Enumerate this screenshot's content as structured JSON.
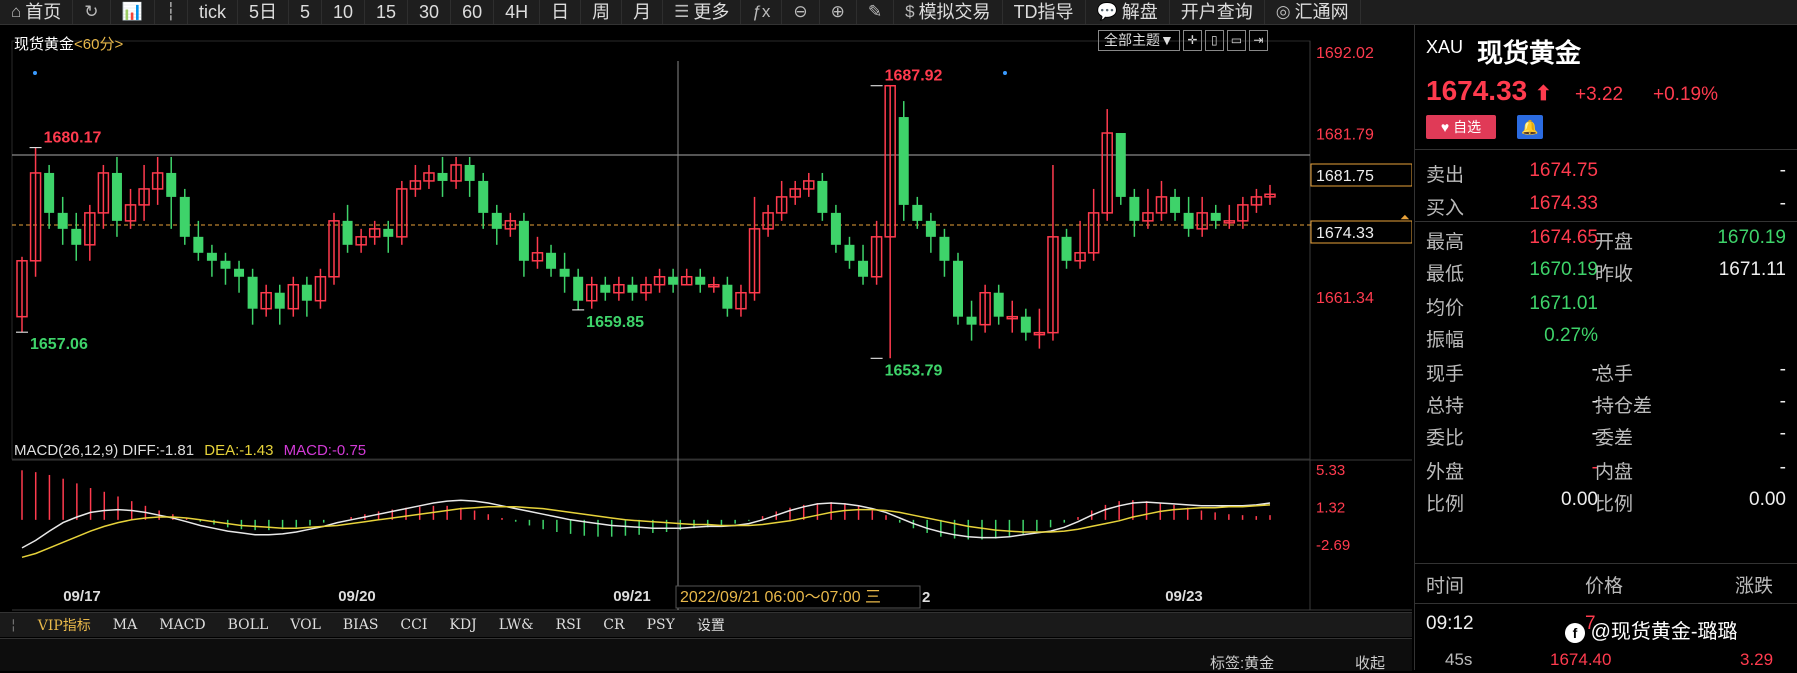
{
  "toolbar": [
    {
      "icon": "⌂",
      "label": "首页"
    },
    {
      "icon": "↻",
      "label": ""
    },
    {
      "icon": "📊",
      "label": ""
    },
    {
      "icon": "┆",
      "label": ""
    },
    {
      "icon": "",
      "label": "tick"
    },
    {
      "icon": "",
      "label": "5日"
    },
    {
      "icon": "",
      "label": "5"
    },
    {
      "icon": "",
      "label": "10"
    },
    {
      "icon": "",
      "label": "15"
    },
    {
      "icon": "",
      "label": "30"
    },
    {
      "icon": "",
      "label": "60"
    },
    {
      "icon": "",
      "label": "4H"
    },
    {
      "icon": "",
      "label": "日"
    },
    {
      "icon": "",
      "label": "周"
    },
    {
      "icon": "",
      "label": "月"
    },
    {
      "icon": "☰",
      "label": "更多"
    },
    {
      "icon": "ƒx",
      "label": ""
    },
    {
      "icon": "⊖",
      "label": ""
    },
    {
      "icon": "⊕",
      "label": ""
    },
    {
      "icon": "✎",
      "label": ""
    },
    {
      "icon": "$",
      "label": "模拟交易"
    },
    {
      "icon": "",
      "label": "TD指导"
    },
    {
      "icon": "💬",
      "label": "解盘"
    },
    {
      "icon": "",
      "label": "开户查询"
    },
    {
      "icon": "◎",
      "label": "汇通网"
    }
  ],
  "chart": {
    "title_name": "现货黄金",
    "title_period": "<60分>",
    "theme_select": "全部主题▼",
    "tool_buttons": [
      "✛",
      "▯",
      "▭",
      "⇥"
    ],
    "y_labels": [
      {
        "v": "1692.02",
        "price": 1692.02,
        "color": "#ff3b4e"
      },
      {
        "v": "1681.79",
        "price": 1681.79,
        "color": "#ff3b4e"
      },
      {
        "v": "1661.34",
        "price": 1661.34,
        "color": "#ff3b4e"
      }
    ],
    "crosshair_price": "1681.75",
    "last_price": "1674.33",
    "marks": [
      {
        "text": "1680.17",
        "color": "#ff3b4e"
      },
      {
        "text": "1657.06",
        "color": "#3ed36a"
      },
      {
        "text": "1659.85",
        "color": "#3ed36a"
      },
      {
        "text": "1687.92",
        "color": "#ff3b4e"
      },
      {
        "text": "1653.79",
        "color": "#3ed36a"
      }
    ],
    "x_labels": [
      "09/17",
      "09/20",
      "09/21",
      "09/23"
    ],
    "x_tooltip": "2022/09/21 06:00～07:00 三",
    "x_after_tip": "2"
  },
  "macd": {
    "name": "MACD(26,12,9)",
    "diff": "DIFF:-1.81",
    "dea": "DEA:-1.43",
    "macd": "MACD:-0.75",
    "y_labels": [
      "5.33",
      "1.32",
      "-2.69"
    ]
  },
  "indicator_tabs": [
    "VIP指标",
    "MA",
    "MACD",
    "BOLL",
    "VOL",
    "BIAS",
    "CCI",
    "KDJ",
    "LW&",
    "RSI",
    "CR",
    "PSY",
    "设置"
  ],
  "footbar": {
    "tag": "标签:黄金",
    "collapse": "收起"
  },
  "quote": {
    "code": "XAU",
    "name": "现货黄金",
    "price": "1674.33",
    "arrow": "⬆",
    "change": "+3.22",
    "pct": "+0.19%",
    "fav": "♥ 自选",
    "bell": "🔔",
    "rows": [
      {
        "a": "卖出",
        "b": "1674.75",
        "bc": "red",
        "c": "",
        "d": "-",
        "dc": "wht"
      },
      {
        "a": "买入",
        "b": "1674.33",
        "bc": "red",
        "c": "",
        "d": "-",
        "dc": "wht"
      },
      {
        "a": "最高",
        "b": "1674.65",
        "bc": "red",
        "c": "开盘",
        "d": "1670.19",
        "dc": "grn"
      },
      {
        "a": "最低",
        "b": "1670.19",
        "bc": "grn",
        "c": "昨收",
        "d": "1671.11",
        "dc": "wht"
      },
      {
        "a": "均价",
        "b": "1671.01",
        "bc": "grn",
        "c": "",
        "d": "",
        "dc": "wht"
      },
      {
        "a": "振幅",
        "b": "0.27%",
        "bc": "grn",
        "c": "",
        "d": "",
        "dc": "wht"
      },
      {
        "a": "现手",
        "b": "-",
        "bc": "wht",
        "c": "总手",
        "d": "-",
        "dc": "wht"
      },
      {
        "a": "总持",
        "b": "-",
        "bc": "wht",
        "c": "持仓差",
        "d": "-",
        "dc": "wht"
      },
      {
        "a": "委比",
        "b": "-",
        "bc": "wht",
        "c": "委差",
        "d": "-",
        "dc": "wht"
      },
      {
        "a": "外盘",
        "b": "-",
        "bc": "red",
        "c": "内盘",
        "d": "-",
        "dc": "wht"
      },
      {
        "a": "比例",
        "b": "0.00",
        "bc": "wht",
        "c": "比例",
        "d": "0.00",
        "dc": "wht"
      }
    ],
    "trade_header": [
      "时间",
      "价格",
      "涨跌"
    ],
    "trades": [
      {
        "t": "09:12",
        "p": "7",
        "c": ""
      },
      {
        "t": "45s",
        "p": "1674.40",
        "c": "3.29"
      }
    ],
    "watermark": "@现货黄金-璐璐"
  },
  "chart_data": {
    "type": "candlestick",
    "y_range": [
      1650,
      1694
    ],
    "candles": [
      [
        1659,
        1666,
        1657.06,
        1666.5
      ],
      [
        1666,
        1677,
        1664,
        1680.17
      ],
      [
        1677,
        1672,
        1670,
        1678
      ],
      [
        1672,
        1670,
        1668,
        1674
      ],
      [
        1670,
        1668,
        1666,
        1672
      ],
      [
        1668,
        1672,
        1666,
        1673
      ],
      [
        1672,
        1677,
        1670,
        1678
      ],
      [
        1677,
        1671,
        1669,
        1679
      ],
      [
        1671,
        1673,
        1670,
        1675
      ],
      [
        1673,
        1675,
        1671,
        1678
      ],
      [
        1675,
        1677,
        1673,
        1679
      ],
      [
        1677,
        1674,
        1670,
        1679
      ],
      [
        1674,
        1669,
        1668,
        1675
      ],
      [
        1669,
        1667,
        1666,
        1671
      ],
      [
        1667,
        1666,
        1664,
        1668
      ],
      [
        1666,
        1665,
        1663,
        1667
      ],
      [
        1665,
        1664,
        1662,
        1666
      ],
      [
        1664,
        1660,
        1658,
        1665
      ],
      [
        1660,
        1662,
        1659,
        1663
      ],
      [
        1662,
        1660,
        1658,
        1663
      ],
      [
        1660,
        1663,
        1659,
        1664
      ],
      [
        1663,
        1661,
        1659,
        1664
      ],
      [
        1661,
        1664,
        1660,
        1665
      ],
      [
        1664,
        1671,
        1663,
        1672
      ],
      [
        1671,
        1668,
        1667,
        1673
      ],
      [
        1668,
        1669,
        1667,
        1670
      ],
      [
        1669,
        1670,
        1668,
        1671
      ],
      [
        1670,
        1669,
        1667,
        1671
      ],
      [
        1669,
        1675,
        1668,
        1676
      ],
      [
        1675,
        1676,
        1674,
        1678
      ],
      [
        1676,
        1677,
        1675,
        1678
      ],
      [
        1677,
        1676,
        1674,
        1679
      ],
      [
        1676,
        1678,
        1675,
        1679
      ],
      [
        1678,
        1676,
        1674,
        1679
      ],
      [
        1676,
        1672,
        1670,
        1677
      ],
      [
        1672,
        1670,
        1668,
        1673
      ],
      [
        1670,
        1671,
        1669,
        1672
      ],
      [
        1671,
        1666,
        1664,
        1672
      ],
      [
        1666,
        1667,
        1665,
        1669
      ],
      [
        1667,
        1665,
        1664,
        1668
      ],
      [
        1665,
        1664,
        1662,
        1667
      ],
      [
        1664,
        1661,
        1659.85,
        1665
      ],
      [
        1661,
        1663,
        1660,
        1664
      ],
      [
        1663,
        1662,
        1661,
        1664
      ],
      [
        1662,
        1663,
        1661,
        1664
      ],
      [
        1663,
        1662,
        1661,
        1664
      ],
      [
        1662,
        1663,
        1661,
        1664
      ],
      [
        1663,
        1664,
        1662,
        1665
      ],
      [
        1664,
        1663,
        1662,
        1665
      ],
      [
        1663,
        1664,
        1663,
        1665
      ],
      [
        1664,
        1663,
        1662,
        1665
      ],
      [
        1663,
        1663,
        1662,
        1664
      ],
      [
        1663,
        1660,
        1659,
        1664
      ],
      [
        1660,
        1662,
        1659,
        1663
      ],
      [
        1662,
        1670,
        1661,
        1674
      ],
      [
        1670,
        1672,
        1669,
        1673
      ],
      [
        1672,
        1674,
        1671,
        1676
      ],
      [
        1674,
        1675,
        1673,
        1676
      ],
      [
        1675,
        1676,
        1674,
        1677
      ],
      [
        1676,
        1672,
        1671,
        1677
      ],
      [
        1672,
        1668,
        1667,
        1673
      ],
      [
        1668,
        1666,
        1665,
        1669
      ],
      [
        1666,
        1664,
        1663,
        1668
      ],
      [
        1664,
        1669,
        1663,
        1671
      ],
      [
        1669,
        1687.92,
        1653.79,
        1687.92
      ],
      [
        1684,
        1673,
        1671,
        1686
      ],
      [
        1673,
        1671,
        1670,
        1674
      ],
      [
        1671,
        1669,
        1667,
        1672
      ],
      [
        1669,
        1666,
        1664,
        1670
      ],
      [
        1666,
        1659,
        1658,
        1667
      ],
      [
        1659,
        1658,
        1656,
        1661
      ],
      [
        1658,
        1662,
        1657,
        1663
      ],
      [
        1662,
        1659,
        1658,
        1663
      ],
      [
        1659,
        1659,
        1657,
        1661
      ],
      [
        1659,
        1657,
        1656,
        1660
      ],
      [
        1657,
        1657,
        1655,
        1660
      ],
      [
        1657,
        1669,
        1656,
        1678
      ],
      [
        1669,
        1666,
        1665,
        1670
      ],
      [
        1666,
        1667,
        1665,
        1671
      ],
      [
        1667,
        1672,
        1666,
        1675
      ],
      [
        1672,
        1682,
        1671,
        1685
      ],
      [
        1682,
        1674,
        1673,
        1682
      ],
      [
        1674,
        1671,
        1669,
        1675
      ],
      [
        1671,
        1672,
        1670,
        1675
      ],
      [
        1672,
        1674,
        1671,
        1676
      ],
      [
        1674,
        1672,
        1671,
        1675
      ],
      [
        1672,
        1670,
        1669,
        1674
      ],
      [
        1670,
        1672,
        1669,
        1674
      ],
      [
        1672,
        1671,
        1670,
        1673
      ],
      [
        1671,
        1671,
        1670,
        1673
      ],
      [
        1671,
        1673,
        1670,
        1674
      ],
      [
        1673,
        1674,
        1672,
        1675
      ],
      [
        1674,
        1674.33,
        1673,
        1675.5
      ]
    ],
    "macd_hist": [
      5.3,
      5.1,
      4.8,
      4.4,
      3.9,
      3.4,
      3.0,
      2.5,
      2.0,
      1.5,
      1.0,
      0.6,
      0.2,
      -0.2,
      -0.5,
      -0.8,
      -1.0,
      -1.1,
      -1.1,
      -1.0,
      -0.8,
      -0.6,
      -0.3,
      0,
      0.3,
      0.6,
      0.9,
      1.1,
      1.3,
      1.4,
      1.5,
      1.5,
      1.3,
      1.0,
      0.6,
      0.2,
      -0.2,
      -0.6,
      -1.0,
      -1.3,
      -1.5,
      -1.7,
      -1.8,
      -1.8,
      -1.7,
      -1.6,
      -1.4,
      -1.3,
      -1.1,
      -0.9,
      -0.8,
      -0.6,
      -0.4,
      -0.1,
      0.4,
      0.9,
      1.3,
      1.6,
      1.8,
      1.9,
      1.8,
      1.5,
      1.0,
      0.5,
      -0.3,
      -0.9,
      -1.4,
      -1.8,
      -2.0,
      -2.1,
      -2.1,
      -2.0,
      -1.8,
      -1.5,
      -1.2,
      -0.8,
      -0.3,
      0.3,
      1.0,
      1.6,
      2.0,
      2.1,
      2.0,
      1.8,
      1.6,
      1.3,
      1.0,
      0.8,
      0.6,
      0.5,
      0.4,
      0.5
    ],
    "diff": [
      -3.0,
      -2.2,
      -1.2,
      -0.3,
      0.3,
      0.8,
      1.0,
      1.1,
      1.0,
      0.8,
      0.5,
      0.2,
      -0.2,
      -0.6,
      -0.9,
      -1.2,
      -1.4,
      -1.6,
      -1.6,
      -1.5,
      -1.3,
      -1.0,
      -0.7,
      -0.3,
      0.0,
      0.3,
      0.6,
      0.9,
      1.2,
      1.5,
      1.8,
      2.0,
      2.1,
      2.0,
      1.8,
      1.5,
      1.2,
      0.9,
      0.6,
      0.3,
      0.0,
      -0.2,
      -0.4,
      -0.6,
      -0.7,
      -0.8,
      -0.9,
      -0.9,
      -0.9,
      -0.8,
      -0.7,
      -0.7,
      -0.6,
      -0.4,
      0.0,
      0.5,
      1.0,
      1.4,
      1.7,
      1.8,
      1.7,
      1.5,
      1.2,
      0.8,
      0.2,
      -0.4,
      -0.9,
      -1.3,
      -1.6,
      -1.8,
      -1.9,
      -1.9,
      -1.8,
      -1.6,
      -1.4,
      -1.2,
      -0.8,
      -0.2,
      0.5,
      1.1,
      1.5,
      1.8,
      1.9,
      1.8,
      1.7,
      1.6,
      1.5,
      1.5,
      1.5,
      1.5,
      1.6,
      1.8
    ],
    "dea": [
      -4.0,
      -3.6,
      -3.0,
      -2.4,
      -1.8,
      -1.2,
      -0.7,
      -0.3,
      0.0,
      0.2,
      0.3,
      0.3,
      0.2,
      0.0,
      -0.2,
      -0.4,
      -0.6,
      -0.7,
      -0.8,
      -0.9,
      -0.9,
      -0.8,
      -0.7,
      -0.6,
      -0.4,
      -0.2,
      0.0,
      0.2,
      0.4,
      0.6,
      0.8,
      1.0,
      1.2,
      1.3,
      1.4,
      1.4,
      1.4,
      1.3,
      1.2,
      1.0,
      0.8,
      0.6,
      0.4,
      0.2,
      0.0,
      -0.1,
      -0.2,
      -0.3,
      -0.4,
      -0.5,
      -0.5,
      -0.6,
      -0.6,
      -0.6,
      -0.5,
      -0.3,
      -0.1,
      0.2,
      0.5,
      0.8,
      1.0,
      1.1,
      1.1,
      1.0,
      0.8,
      0.5,
      0.2,
      -0.1,
      -0.4,
      -0.7,
      -0.9,
      -1.1,
      -1.2,
      -1.3,
      -1.3,
      -1.3,
      -1.2,
      -1.0,
      -0.7,
      -0.4,
      -0.1,
      0.3,
      0.6,
      0.9,
      1.1,
      1.2,
      1.3,
      1.3,
      1.4,
      1.4,
      1.5,
      1.6
    ]
  }
}
